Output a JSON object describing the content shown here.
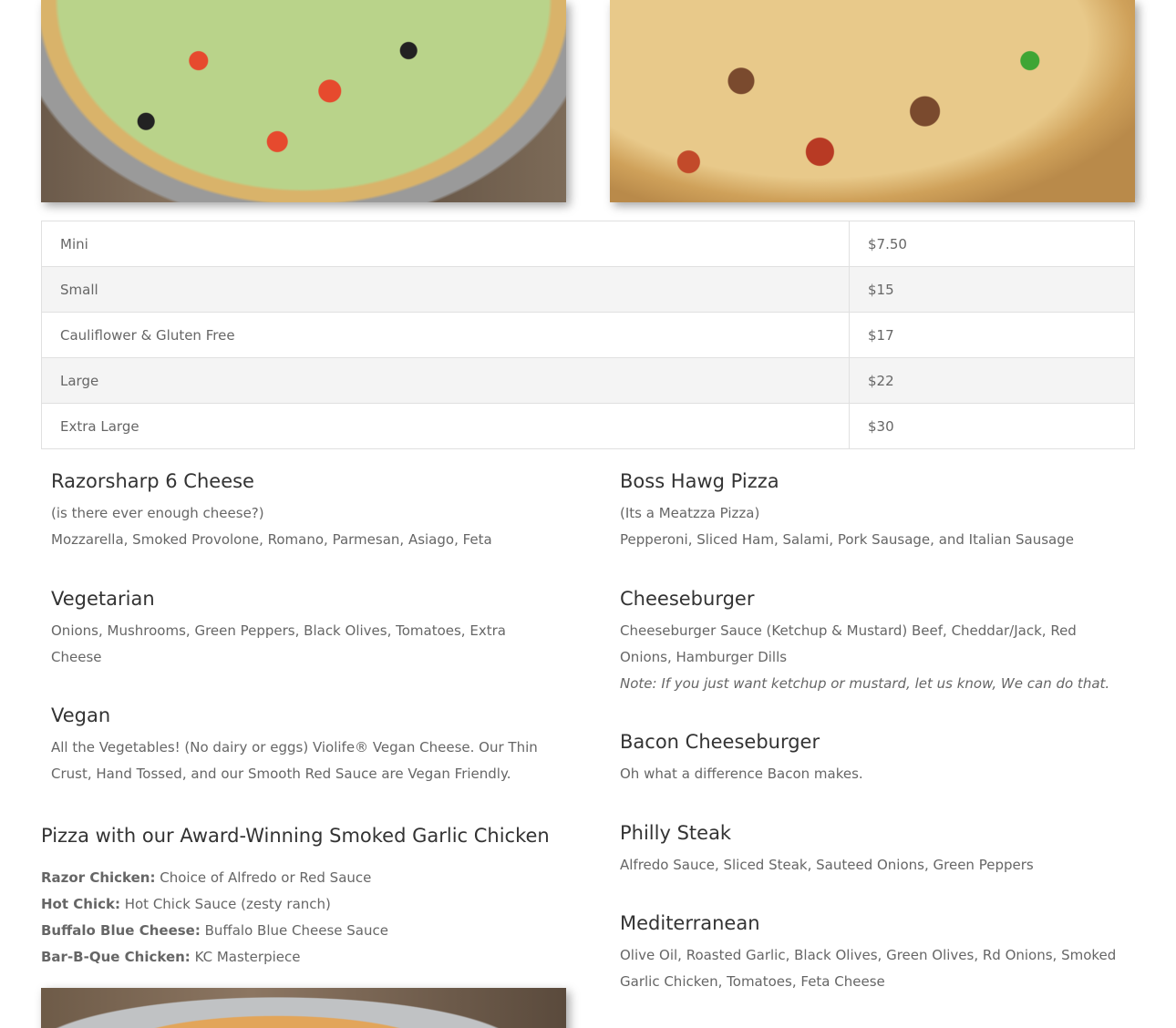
{
  "sizes": [
    {
      "size": "Mini",
      "price": "$7.50"
    },
    {
      "size": "Small",
      "price": "$15"
    },
    {
      "size": "Cauliflower & Gluten Free",
      "price": "$17"
    },
    {
      "size": "Large",
      "price": "$22"
    },
    {
      "size": "Extra Large",
      "price": "$30"
    }
  ],
  "left_items": [
    {
      "title": "Razorsharp 6 Cheese",
      "subtitle": "(is there ever enough cheese?)",
      "desc": "Mozzarella, Smoked Provolone, Romano, Parmesan, Asiago,  Feta"
    },
    {
      "title": "Vegetarian",
      "desc": "Onions, Mushrooms, Green Peppers, Black Olives, Tomatoes, Extra Cheese"
    },
    {
      "title": "Vegan",
      "desc": "All the Vegetables! (No dairy or eggs) Violife® Vegan Cheese. Our Thin Crust, Hand Tossed, and our Smooth Red Sauce are Vegan Friendly."
    }
  ],
  "right_items": [
    {
      "title": "Boss Hawg Pizza",
      "subtitle": "(Its a Meatzza Pizza)",
      "desc": "Pepperoni, Sliced Ham, Salami, Pork Sausage, and Italian Sausage"
    },
    {
      "title": "Cheeseburger",
      "desc": "Cheeseburger Sauce (Ketchup & Mustard) Beef, Cheddar/Jack, Red Onions, Hamburger Dills",
      "note": "Note: If you just want ketchup or mustard, let us know, We can do that."
    },
    {
      "title": "Bacon Cheeseburger",
      "desc": "Oh what a difference Bacon makes."
    },
    {
      "title": "Philly Steak",
      "desc": "Alfredo Sauce, Sliced Steak, Sauteed Onions, Green Peppers"
    },
    {
      "title": "Mediterranean",
      "desc": "Olive Oil, Roasted Garlic, Black Olives, Green Olives, Rd Onions, Smoked Garlic Chicken, Tomatoes, Feta Cheese"
    }
  ],
  "chicken": {
    "heading": "Pizza with our Award-Winning Smoked Garlic Chicken",
    "items": [
      {
        "name": "Razor Chicken:",
        "desc": " Choice of Alfredo or Red Sauce"
      },
      {
        "name": "Hot Chick:",
        "desc": " Hot Chick Sauce (zesty ranch)"
      },
      {
        "name": "Buffalo Blue Cheese:",
        "desc": " Buffalo Blue Cheese Sauce"
      },
      {
        "name": "Bar-B-Que Chicken:",
        "desc": " KC Masterpiece"
      }
    ]
  }
}
